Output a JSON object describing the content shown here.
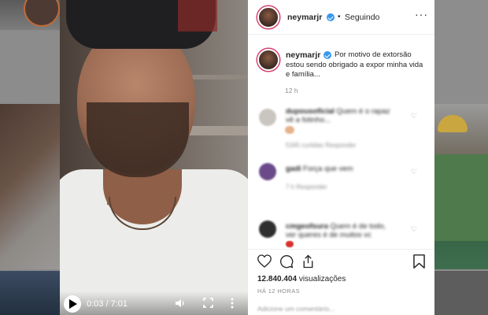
{
  "post": {
    "username": "neymarjr",
    "follow_status": "Seguindo",
    "separator": "•",
    "caption": "Por motivo de extorsão estou sendo obrigado a expor minha vida e família...",
    "caption_time": "12 h",
    "views_count": "12.840.404",
    "views_label": "visualizações",
    "time_ago": "HÁ 12 HORAS",
    "add_comment_placeholder": "Adicione um comentário..."
  },
  "video": {
    "current_time": "0:03",
    "duration": "7:01",
    "time_separator": "/"
  },
  "comments": [
    {
      "user": "dupousoficial",
      "text": "Quem é o rapaz vê a fotinho...",
      "meta": "5345 curtidas   Responder"
    },
    {
      "user": "gadi",
      "text": "Força que vem",
      "meta": "7 h   Responder"
    },
    {
      "user": "cmgeofsura",
      "text": "Quem é de todo, ver queres é de muitos vc",
      "meta": ""
    }
  ],
  "icons": {
    "like": "heart-icon",
    "comment": "comment-icon",
    "share": "share-icon",
    "save": "bookmark-icon",
    "play": "play-icon",
    "volume": "volume-icon",
    "fullscreen": "fullscreen-icon",
    "options": "more-vert-icon"
  },
  "colors": {
    "verified": "#3897f0",
    "story_ring": "#d63a6a",
    "text_primary": "#262626",
    "text_secondary": "#8e8e8e"
  }
}
